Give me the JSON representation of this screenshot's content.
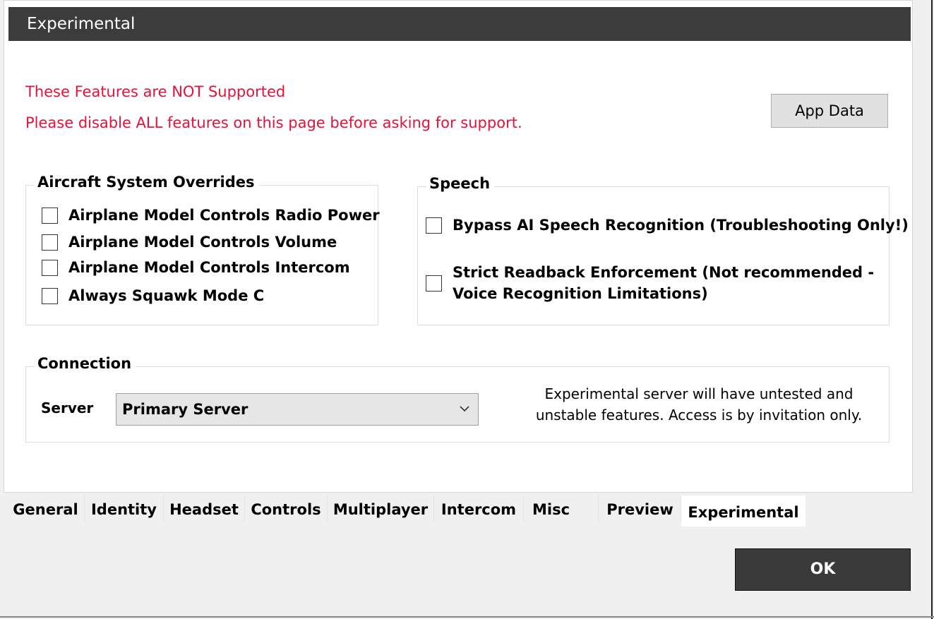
{
  "header": {
    "title": "Experimental"
  },
  "warnings": {
    "line1": "These Features are NOT Supported",
    "line2": "Please disable ALL features on this page before asking for support."
  },
  "app_data_button": {
    "label": "App Data"
  },
  "aircraft_overrides": {
    "title": "Aircraft System Overrides",
    "items": [
      {
        "label": "Airplane Model Controls Radio Power",
        "checked": false
      },
      {
        "label": "Airplane Model Controls Volume",
        "checked": false
      },
      {
        "label": "Airplane Model Controls Intercom",
        "checked": false
      },
      {
        "label": "Always Squawk Mode C",
        "checked": false
      }
    ]
  },
  "speech": {
    "title": "Speech",
    "items": [
      {
        "label": "Bypass AI Speech Recognition (Troubleshooting Only!)",
        "checked": false
      },
      {
        "label_line1": "Strict Readback Enforcement (Not recommended -",
        "label_line2": "Voice Recognition Limitations)",
        "checked": false
      }
    ]
  },
  "connection": {
    "title": "Connection",
    "server_label": "Server",
    "server_value": "Primary Server",
    "info_line1": "Experimental server will have untested and",
    "info_line2": "unstable features. Access is by invitation only."
  },
  "tabs": [
    {
      "label": "General",
      "active": false
    },
    {
      "label": "Identity",
      "active": false
    },
    {
      "label": "Headset",
      "active": false
    },
    {
      "label": "Controls",
      "active": false
    },
    {
      "label": "Multiplayer",
      "active": false
    },
    {
      "label": "Intercom",
      "active": false
    },
    {
      "label": "Misc",
      "active": false
    },
    {
      "label": "Preview",
      "active": false
    },
    {
      "label": "Experimental",
      "active": true
    }
  ],
  "ok_button": {
    "label": "OK"
  },
  "colors": {
    "warning": "#e8113a",
    "header_bg": "#3c3c3c",
    "ok_bg": "#3a3a3a"
  }
}
